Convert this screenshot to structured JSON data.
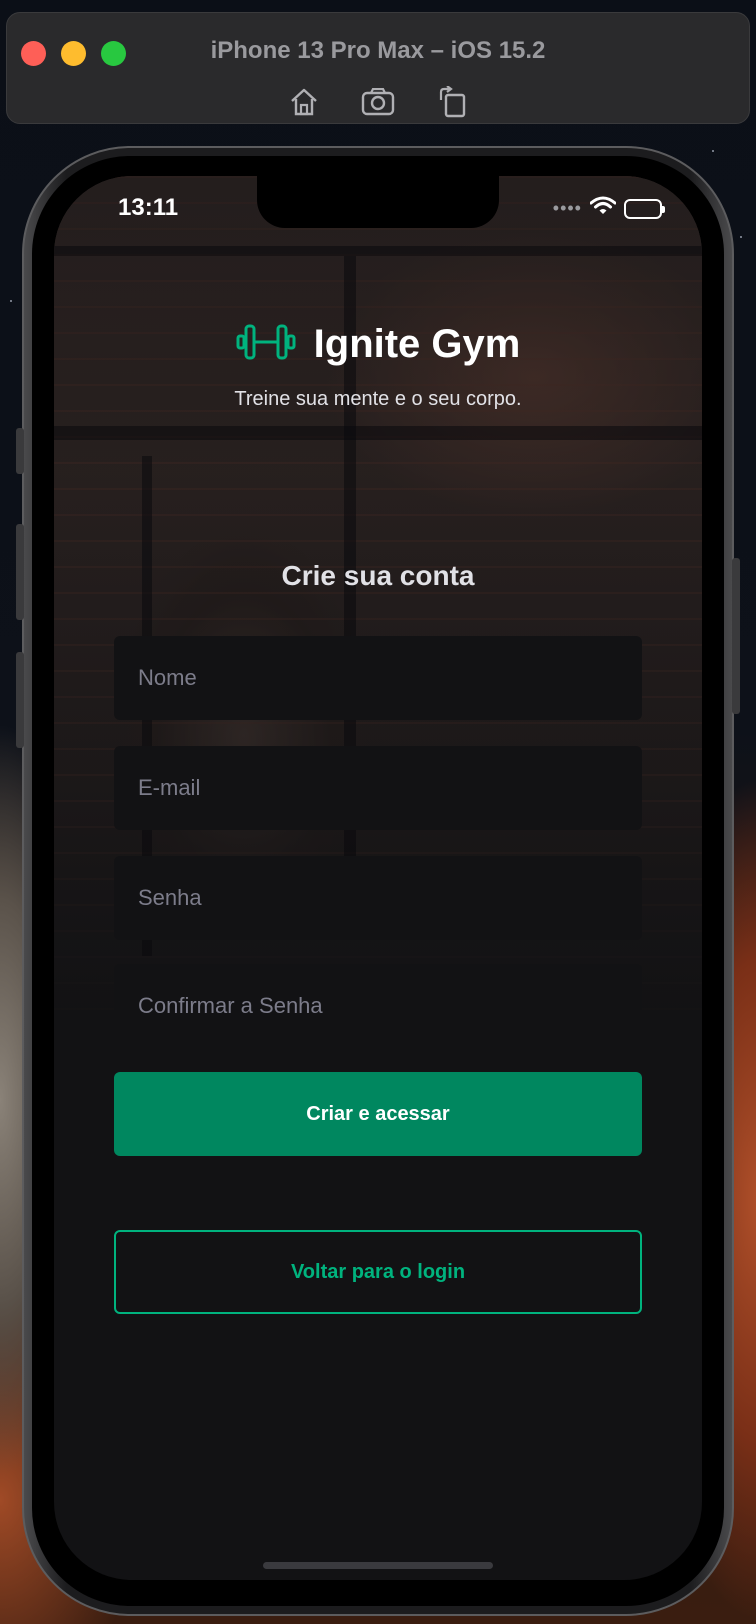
{
  "simulator": {
    "title": "iPhone 13 Pro Max – iOS 15.2",
    "tools": [
      "home-icon",
      "screenshot-icon",
      "rotate-icon"
    ]
  },
  "status_bar": {
    "time": "13:11",
    "signal_dots": "••••"
  },
  "app": {
    "brand": {
      "name": "Ignite Gym",
      "logo_icon": "dumbbell-icon"
    },
    "tagline": "Treine sua mente e o seu corpo.",
    "form": {
      "title": "Crie sua conta",
      "name_placeholder": "Nome",
      "email_placeholder": "E-mail",
      "password_placeholder": "Senha",
      "confirm_password_placeholder": "Confirmar a Senha",
      "submit_label": "Criar e acessar",
      "back_label": "Voltar para o login"
    }
  },
  "colors": {
    "primary": "#00875F",
    "accent": "#00B37E",
    "background": "#121214",
    "text": "#E1E1E6",
    "placeholder": "#7C7C8A"
  }
}
